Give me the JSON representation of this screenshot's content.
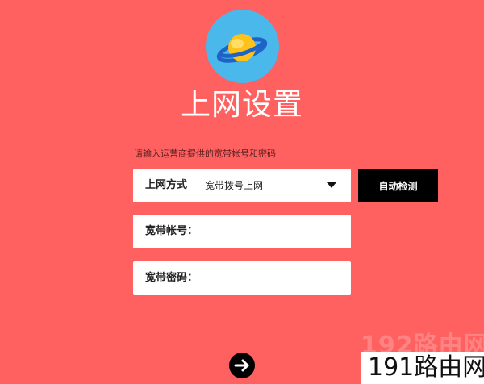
{
  "header": {
    "logo_icon": "planet-icon",
    "title": "上网设置"
  },
  "form": {
    "hint": "请输入运营商提供的宽带帐号和密码",
    "connection_mode": {
      "label": "上网方式",
      "value": "宽带拨号上网"
    },
    "detect_button": "自动检测",
    "account": {
      "label": "宽带帐号：",
      "value": ""
    },
    "password": {
      "label": "宽带密码：",
      "value": ""
    },
    "next_icon": "arrow-right-icon"
  },
  "watermark": {
    "faint_text": "192路由网",
    "text": "191路由网"
  },
  "colors": {
    "background": "#ff6060",
    "logo_circle": "#4ab8ea",
    "planet": "#ffc21a",
    "ring": "#1f63c7",
    "button": "#000000"
  }
}
